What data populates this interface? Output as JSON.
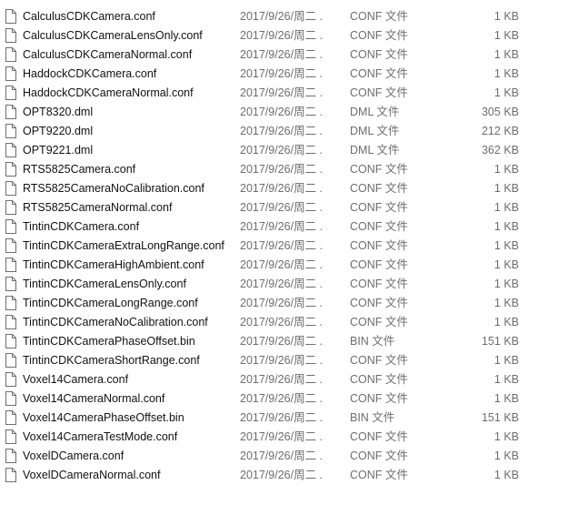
{
  "files": [
    {
      "name": "CalculusCDKCamera.conf",
      "date": "2017/9/26/周二 ...",
      "type": "CONF 文件",
      "size": "1 KB"
    },
    {
      "name": "CalculusCDKCameraLensOnly.conf",
      "date": "2017/9/26/周二 ...",
      "type": "CONF 文件",
      "size": "1 KB"
    },
    {
      "name": "CalculusCDKCameraNormal.conf",
      "date": "2017/9/26/周二 ...",
      "type": "CONF 文件",
      "size": "1 KB"
    },
    {
      "name": "HaddockCDKCamera.conf",
      "date": "2017/9/26/周二 ...",
      "type": "CONF 文件",
      "size": "1 KB"
    },
    {
      "name": "HaddockCDKCameraNormal.conf",
      "date": "2017/9/26/周二 ...",
      "type": "CONF 文件",
      "size": "1 KB"
    },
    {
      "name": "OPT8320.dml",
      "date": "2017/9/26/周二 ...",
      "type": "DML 文件",
      "size": "305 KB"
    },
    {
      "name": "OPT9220.dml",
      "date": "2017/9/26/周二 ...",
      "type": "DML 文件",
      "size": "212 KB"
    },
    {
      "name": "OPT9221.dml",
      "date": "2017/9/26/周二 ...",
      "type": "DML 文件",
      "size": "362 KB"
    },
    {
      "name": "RTS5825Camera.conf",
      "date": "2017/9/26/周二 ...",
      "type": "CONF 文件",
      "size": "1 KB"
    },
    {
      "name": "RTS5825CameraNoCalibration.conf",
      "date": "2017/9/26/周二 ...",
      "type": "CONF 文件",
      "size": "1 KB"
    },
    {
      "name": "RTS5825CameraNormal.conf",
      "date": "2017/9/26/周二 ...",
      "type": "CONF 文件",
      "size": "1 KB"
    },
    {
      "name": "TintinCDKCamera.conf",
      "date": "2017/9/26/周二 ...",
      "type": "CONF 文件",
      "size": "1 KB"
    },
    {
      "name": "TintinCDKCameraExtraLongRange.conf",
      "date": "2017/9/26/周二 ...",
      "type": "CONF 文件",
      "size": "1 KB"
    },
    {
      "name": "TintinCDKCameraHighAmbient.conf",
      "date": "2017/9/26/周二 ...",
      "type": "CONF 文件",
      "size": "1 KB"
    },
    {
      "name": "TintinCDKCameraLensOnly.conf",
      "date": "2017/9/26/周二 ...",
      "type": "CONF 文件",
      "size": "1 KB"
    },
    {
      "name": "TintinCDKCameraLongRange.conf",
      "date": "2017/9/26/周二 ...",
      "type": "CONF 文件",
      "size": "1 KB"
    },
    {
      "name": "TintinCDKCameraNoCalibration.conf",
      "date": "2017/9/26/周二 ...",
      "type": "CONF 文件",
      "size": "1 KB"
    },
    {
      "name": "TintinCDKCameraPhaseOffset.bin",
      "date": "2017/9/26/周二 ...",
      "type": "BIN 文件",
      "size": "151 KB"
    },
    {
      "name": "TintinCDKCameraShortRange.conf",
      "date": "2017/9/26/周二 ...",
      "type": "CONF 文件",
      "size": "1 KB"
    },
    {
      "name": "Voxel14Camera.conf",
      "date": "2017/9/26/周二 ...",
      "type": "CONF 文件",
      "size": "1 KB"
    },
    {
      "name": "Voxel14CameraNormal.conf",
      "date": "2017/9/26/周二 ...",
      "type": "CONF 文件",
      "size": "1 KB"
    },
    {
      "name": "Voxel14CameraPhaseOffset.bin",
      "date": "2017/9/26/周二 ...",
      "type": "BIN 文件",
      "size": "151 KB"
    },
    {
      "name": "Voxel14CameraTestMode.conf",
      "date": "2017/9/26/周二 ...",
      "type": "CONF 文件",
      "size": "1 KB"
    },
    {
      "name": "VoxelDCamera.conf",
      "date": "2017/9/26/周二 ...",
      "type": "CONF 文件",
      "size": "1 KB"
    },
    {
      "name": "VoxelDCameraNormal.conf",
      "date": "2017/9/26/周二 ...",
      "type": "CONF 文件",
      "size": "1 KB"
    }
  ],
  "icon": "generic-file-icon",
  "colors": {
    "name_text": "#111111",
    "meta_text": "#6d6d6d",
    "hover_row": "#e5f3ff",
    "icon_stroke": "#6e6e6e"
  }
}
